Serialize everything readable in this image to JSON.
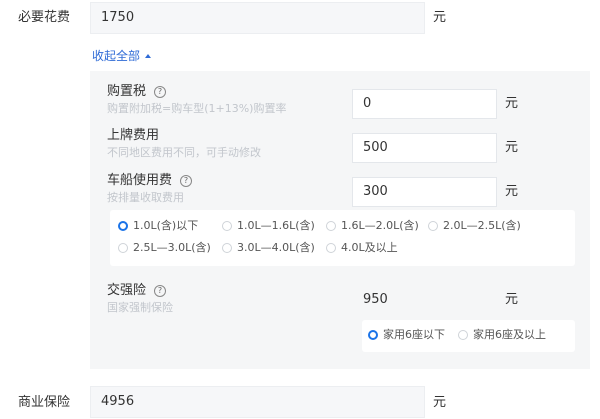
{
  "must_fee": {
    "label": "必要花费",
    "value": "1750",
    "unit": "元"
  },
  "toggle": {
    "label": "收起全部"
  },
  "purchase_tax": {
    "label": "购置税",
    "hint": "购置附加税=购车型(1+13%)购置率",
    "value": "0",
    "unit": "元"
  },
  "plate_fee": {
    "label": "上牌费用",
    "hint": "不同地区费用不同，可手动修改",
    "value": "500",
    "unit": "元"
  },
  "vehicle_tax": {
    "label": "车船使用费",
    "hint": "按排量收取费用",
    "value": "300",
    "unit": "元",
    "options": [
      "1.0L(含)以下",
      "1.0L—1.6L(含)",
      "1.6L—2.0L(含)",
      "2.0L—2.5L(含)",
      "2.5L—3.0L(含)",
      "3.0L—4.0L(含)",
      "4.0L及以上"
    ],
    "selected": "1.0L(含)以下"
  },
  "compulsory_ins": {
    "label": "交强险",
    "hint": "国家强制保险",
    "value": "950",
    "unit": "元",
    "options": [
      "家用6座以下",
      "家用6座及以上"
    ],
    "selected": "家用6座以下"
  },
  "commercial_ins": {
    "label": "商业保险",
    "value": "4956",
    "unit": "元"
  },
  "colors": {
    "accent": "#1a73e8",
    "link": "#2f6bd6",
    "hint": "#c2c6cc"
  },
  "icons": {
    "help": "question-circle-icon",
    "collapse": "caret-up-icon"
  }
}
